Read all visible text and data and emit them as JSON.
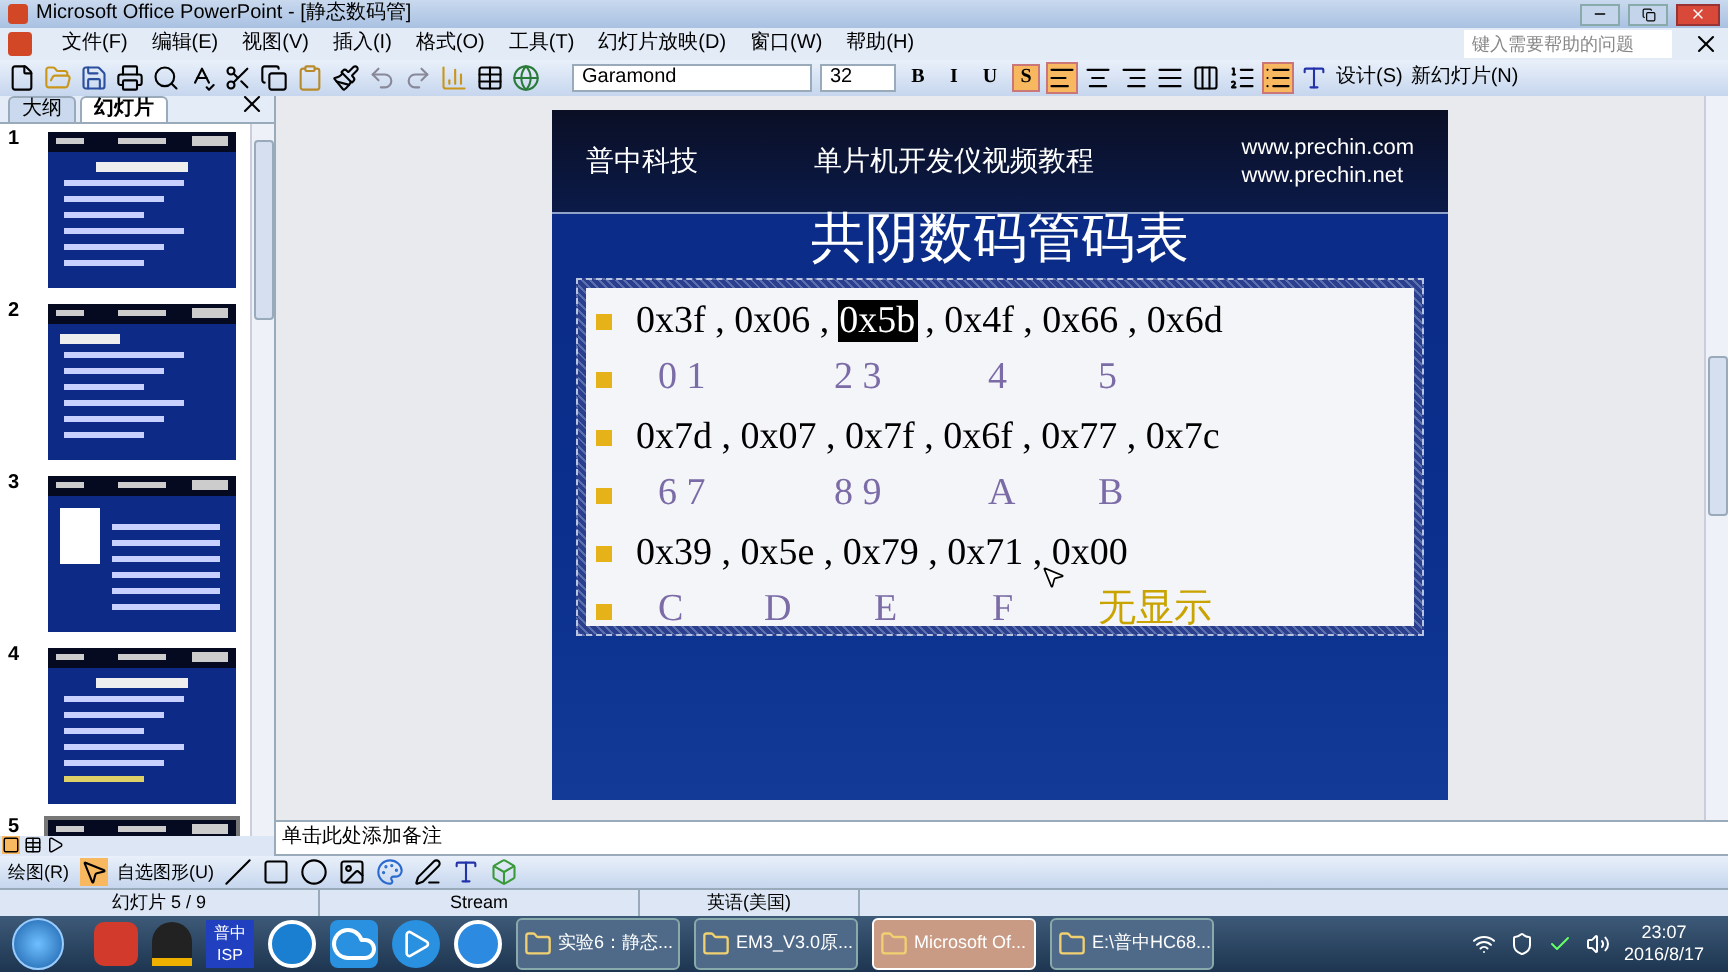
{
  "window": {
    "title": "Microsoft Office PowerPoint - [静态数码管]"
  },
  "menu": [
    "文件(F)",
    "编辑(E)",
    "视图(V)",
    "插入(I)",
    "格式(O)",
    "工具(T)",
    "幻灯片放映(D)",
    "窗口(W)",
    "帮助(H)"
  ],
  "help_search": {
    "placeholder": "键入需要帮助的问题"
  },
  "formatting": {
    "font": "Garamond",
    "size": "32",
    "design": "设计(S)",
    "new_slide": "新幻灯片(N)",
    "style_buttons": [
      {
        "label": "B",
        "selected": false
      },
      {
        "label": "I",
        "selected": false
      },
      {
        "label": "U",
        "selected": false
      },
      {
        "label": "S",
        "selected": true
      }
    ],
    "alignment": [
      {
        "selected": true
      },
      {
        "selected": false
      },
      {
        "selected": false
      },
      {
        "selected": false
      },
      {
        "selected": false
      }
    ],
    "lists": [
      {
        "selected": false
      },
      {
        "selected": true
      }
    ]
  },
  "panel_tabs": [
    {
      "label": "大纲",
      "selected": false
    },
    {
      "label": "幻灯片",
      "selected": true
    }
  ],
  "thumbnails": [
    {
      "number": "1",
      "selected": false
    },
    {
      "number": "2",
      "selected": false
    },
    {
      "number": "3",
      "selected": false
    },
    {
      "number": "4",
      "selected": false
    },
    {
      "number": "5",
      "selected": true
    }
  ],
  "slide": {
    "header_left": "普中科技",
    "header_center": "单片机开发仪视频教程",
    "urls": [
      "www.prechin.com",
      "www.prechin.net"
    ],
    "title": "共阴数码管码表",
    "lines": [
      {
        "kind": "code",
        "parts": [
          {
            "text": "0x3f , 0x06 ,",
            "selected": false
          },
          {
            "text": "0x5b",
            "selected": true
          },
          {
            "text": ", 0x4f , 0x66 , 0x6d",
            "selected": false
          }
        ]
      },
      {
        "kind": "labels",
        "labels": [
          {
            "text": "0 1",
            "color": "#7b6ba6"
          },
          {
            "text": "2 3",
            "color": "#7b6ba6"
          },
          {
            "text": "4",
            "color": "#7b6ba6"
          },
          {
            "text": "5",
            "color": "#7b6ba6"
          }
        ]
      },
      {
        "kind": "code",
        "parts": [
          {
            "text": "0x7d , 0x07 , 0x7f , 0x6f , 0x77 , 0x7c",
            "selected": false
          }
        ]
      },
      {
        "kind": "labels",
        "labels": [
          {
            "text": "6 7",
            "color": "#7b6ba6"
          },
          {
            "text": "8 9",
            "color": "#7b6ba6"
          },
          {
            "text": "A",
            "color": "#7b6ba6"
          },
          {
            "text": "B",
            "color": "#7b6ba6"
          }
        ]
      },
      {
        "kind": "code",
        "parts": [
          {
            "text": "0x39 , 0x5e , 0x79 , 0x71 , 0x00",
            "selected": false
          }
        ]
      },
      {
        "kind": "labels",
        "labels": [
          {
            "text": "C",
            "color": "#7b6ba6"
          },
          {
            "text": "D",
            "color": "#7b6ba6"
          },
          {
            "text": "E",
            "color": "#7b6ba6"
          },
          {
            "text": "F",
            "color": "#7b6ba6"
          },
          {
            "text": "无显示",
            "color": "#c9a400"
          }
        ]
      }
    ]
  },
  "notes": {
    "placeholder": "单击此处添加备注"
  },
  "drawing_toolbar": {
    "draw": "绘图(R)",
    "autoshapes": "自选图形(U)"
  },
  "status_bar": [
    "幻灯片 5 / 9",
    "Stream",
    "英语(美国)"
  ],
  "taskbar": {
    "isp_label": [
      "普中",
      "ISP"
    ],
    "windows": [
      {
        "label": "实验6：静态...",
        "selected": false
      },
      {
        "label": "EM3_V3.0原...",
        "selected": false
      },
      {
        "label": "Microsoft Of...",
        "selected": true
      },
      {
        "label": "E:\\普中HC68...",
        "selected": false
      }
    ],
    "time": "23:07",
    "date": "2016/8/17"
  }
}
